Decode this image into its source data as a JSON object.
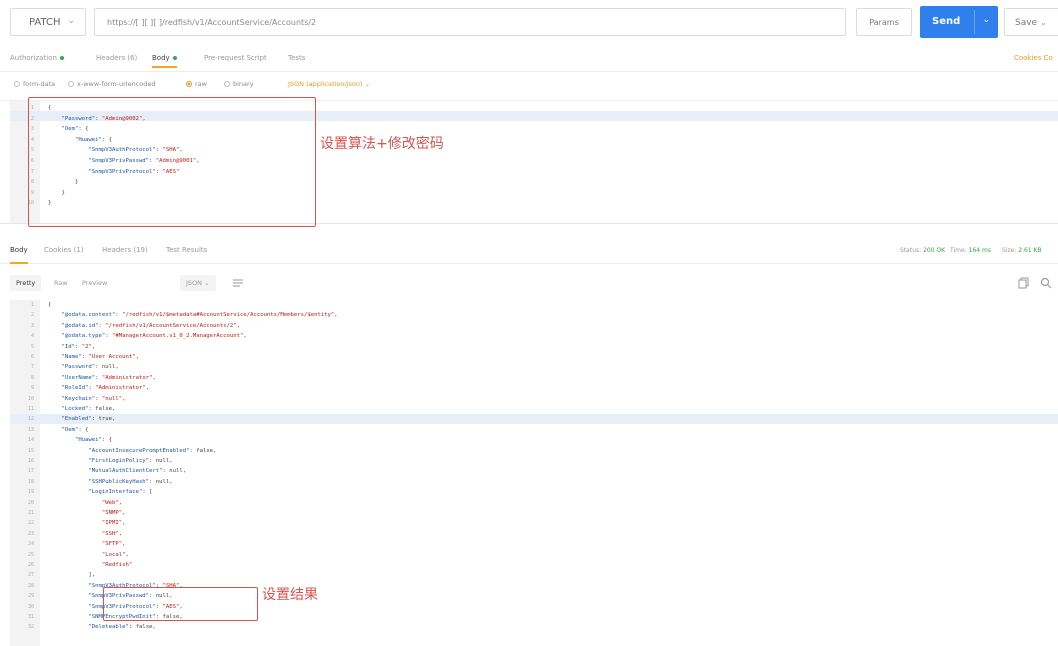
{
  "request": {
    "method": "PATCH",
    "url": "https://[ ][ ][ ]/redfish/v1/AccountService/Accounts/2",
    "params_label": "Params",
    "send_label": "Send",
    "save_label": "Save"
  },
  "request_tabs": {
    "authorization": "Authorization",
    "headers": "Headers (6)",
    "body": "Body",
    "prerequest": "Pre-request Script",
    "tests": "Tests",
    "right": "Cookies  Co"
  },
  "body_types": {
    "form_data": "form-data",
    "urlencoded": "x-www-form-urlencoded",
    "raw": "raw",
    "binary": "binary",
    "json_type": "JSON (application/json)"
  },
  "request_body": [
    {
      "n": "1",
      "text": "{"
    },
    {
      "n": "2",
      "text": "    \"Password\": \"Admin@9002\","
    },
    {
      "n": "3",
      "text": "    \"Oem\": {"
    },
    {
      "n": "4",
      "text": "        \"Huawei\": {"
    },
    {
      "n": "5",
      "text": "            \"SnmpV3AuthProtocol\": \"SHA\","
    },
    {
      "n": "6",
      "text": "            \"SnmpV3PrivPasswd\": \"Admin@9001\","
    },
    {
      "n": "7",
      "text": "            \"SnmpV3PrivProtocol\": \"AES\""
    },
    {
      "n": "8",
      "text": "        }"
    },
    {
      "n": "9",
      "text": "    }"
    },
    {
      "n": "10",
      "text": "}"
    }
  ],
  "annotations": {
    "top": "设置算法+修改密码",
    "bottom": "设置结果"
  },
  "response_tabs": {
    "body": "Body",
    "cookies": "Cookies (1)",
    "headers": "Headers (19)",
    "tests": "Test Results"
  },
  "response_status": {
    "status_label": "Status:",
    "status_value": "200 OK",
    "time_label": "Time:",
    "time_value": "164 ms",
    "size_label": "Size:",
    "size_value": "2.61 KB"
  },
  "view_options": {
    "pretty": "Pretty",
    "raw": "Raw",
    "preview": "Preview",
    "format": "JSON"
  },
  "response_body": [
    {
      "n": "1",
      "text": "{"
    },
    {
      "n": "2",
      "text": "    \"@odata.context\": \"/redfish/v1/$metadata#AccountService/Accounts/Members/$entity\","
    },
    {
      "n": "3",
      "text": "    \"@odata.id\": \"/redfish/v1/AccountService/Accounts/2\","
    },
    {
      "n": "4",
      "text": "    \"@odata.type\": \"#ManagerAccount.v1_0_2.ManagerAccount\","
    },
    {
      "n": "5",
      "text": "    \"Id\": \"2\","
    },
    {
      "n": "6",
      "text": "    \"Name\": \"User Account\","
    },
    {
      "n": "7",
      "text": "    \"Password\": null,"
    },
    {
      "n": "8",
      "text": "    \"UserName\": \"Administrator\","
    },
    {
      "n": "9",
      "text": "    \"RoleId\": \"Administrator\","
    },
    {
      "n": "10",
      "text": "    \"Keychain\": \"null\","
    },
    {
      "n": "11",
      "text": "    \"Locked\": false,"
    },
    {
      "n": "12",
      "text": "    \"Enabled\": true,"
    },
    {
      "n": "13",
      "text": "    \"Oem\": {"
    },
    {
      "n": "14",
      "text": "        \"Huawei\": {"
    },
    {
      "n": "15",
      "text": "            \"AccountInsecurePromptEnabled\": false,"
    },
    {
      "n": "16",
      "text": "            \"FirstLoginPolicy\": null,"
    },
    {
      "n": "17",
      "text": "            \"MutualAuthClientCert\": null,"
    },
    {
      "n": "18",
      "text": "            \"SSHPublicKeyHash\": null,"
    },
    {
      "n": "19",
      "text": "            \"LoginInterface\": ["
    },
    {
      "n": "20",
      "text": "                \"Web\","
    },
    {
      "n": "21",
      "text": "                \"SNMP\","
    },
    {
      "n": "22",
      "text": "                \"IPMI\","
    },
    {
      "n": "23",
      "text": "                \"SSH\","
    },
    {
      "n": "24",
      "text": "                \"SFTP\","
    },
    {
      "n": "25",
      "text": "                \"Local\","
    },
    {
      "n": "26",
      "text": "                \"Redfish\""
    },
    {
      "n": "27",
      "text": "            ],"
    },
    {
      "n": "28",
      "text": "            \"SnmpV3AuthProtocol\": \"SHA\","
    },
    {
      "n": "29",
      "text": "            \"SnmpV3PrivPasswd\": null,"
    },
    {
      "n": "30",
      "text": "            \"SnmpV3PrivProtocol\": \"AES\","
    },
    {
      "n": "31",
      "text": "            \"SNMPEncryptPwdInit\": false,"
    },
    {
      "n": "32",
      "text": "            \"Deleteable\": false,"
    }
  ],
  "colors": {
    "accent": "#2f80ed",
    "tab_indicator": "#f6a623",
    "annotation": "#d9534f",
    "status_ok": "#3aa54a"
  }
}
